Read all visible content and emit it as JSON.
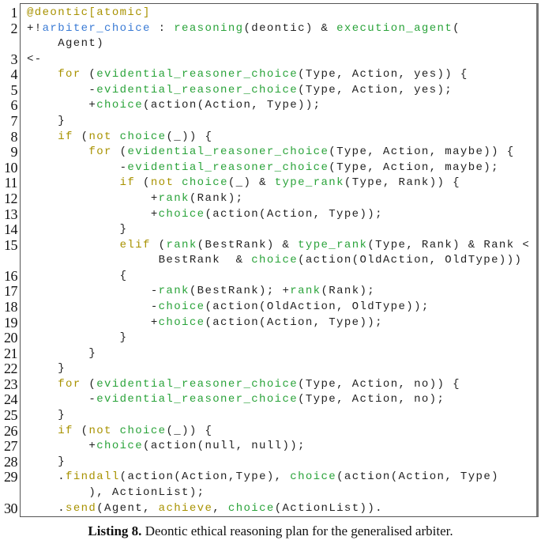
{
  "listing": {
    "caption_label": "Listing 8.",
    "caption_text": " Deontic ethical reasoning plan for the generalised arbiter.",
    "colors": {
      "keyword": "#a89200",
      "identifier": "#2aa33a",
      "goal": "#3a7bd5",
      "text": "#222222"
    },
    "lines": [
      {
        "n": "1",
        "tokens": [
          [
            "kw",
            "@deontic[atomic]"
          ]
        ]
      },
      {
        "n": "2",
        "tokens": [
          [
            "t",
            "+!"
          ],
          [
            "bl",
            "arbiter_choice"
          ],
          [
            "t",
            " : "
          ],
          [
            "fn",
            "reasoning"
          ],
          [
            "t",
            "(deontic) & "
          ],
          [
            "fn",
            "execution_agent"
          ],
          [
            "t",
            "("
          ]
        ]
      },
      {
        "n": "",
        "tokens": [
          [
            "t",
            "    Agent)"
          ]
        ]
      },
      {
        "n": "3",
        "tokens": [
          [
            "t",
            "<-"
          ]
        ]
      },
      {
        "n": "4",
        "tokens": [
          [
            "t",
            "    "
          ],
          [
            "kw",
            "for"
          ],
          [
            "t",
            " ("
          ],
          [
            "fn",
            "evidential_reasoner_choice"
          ],
          [
            "t",
            "(Type, Action, yes)) {"
          ]
        ]
      },
      {
        "n": "5",
        "tokens": [
          [
            "t",
            "        -"
          ],
          [
            "fn",
            "evidential_reasoner_choice"
          ],
          [
            "t",
            "(Type, Action, yes);"
          ]
        ]
      },
      {
        "n": "6",
        "tokens": [
          [
            "t",
            "        +"
          ],
          [
            "fn",
            "choice"
          ],
          [
            "t",
            "(action(Action, Type));"
          ]
        ]
      },
      {
        "n": "7",
        "tokens": [
          [
            "t",
            "    }"
          ]
        ]
      },
      {
        "n": "8",
        "tokens": [
          [
            "t",
            "    "
          ],
          [
            "kw",
            "if"
          ],
          [
            "t",
            " ("
          ],
          [
            "kw",
            "not"
          ],
          [
            "t",
            " "
          ],
          [
            "fn",
            "choice"
          ],
          [
            "t",
            "(_)) {"
          ]
        ]
      },
      {
        "n": "9",
        "tokens": [
          [
            "t",
            "        "
          ],
          [
            "kw",
            "for"
          ],
          [
            "t",
            " ("
          ],
          [
            "fn",
            "evidential_reasoner_choice"
          ],
          [
            "t",
            "(Type, Action, maybe)) {"
          ]
        ]
      },
      {
        "n": "10",
        "tokens": [
          [
            "t",
            "            -"
          ],
          [
            "fn",
            "evidential_reasoner_choice"
          ],
          [
            "t",
            "(Type, Action, maybe);"
          ]
        ]
      },
      {
        "n": "11",
        "tokens": [
          [
            "t",
            "            "
          ],
          [
            "kw",
            "if"
          ],
          [
            "t",
            " ("
          ],
          [
            "kw",
            "not"
          ],
          [
            "t",
            " "
          ],
          [
            "fn",
            "choice"
          ],
          [
            "t",
            "(_) & "
          ],
          [
            "fn",
            "type_rank"
          ],
          [
            "t",
            "(Type, Rank)) {"
          ]
        ]
      },
      {
        "n": "12",
        "tokens": [
          [
            "t",
            "                +"
          ],
          [
            "fn",
            "rank"
          ],
          [
            "t",
            "(Rank);"
          ]
        ]
      },
      {
        "n": "13",
        "tokens": [
          [
            "t",
            "                +"
          ],
          [
            "fn",
            "choice"
          ],
          [
            "t",
            "(action(Action, Type));"
          ]
        ]
      },
      {
        "n": "14",
        "tokens": [
          [
            "t",
            "            }"
          ]
        ]
      },
      {
        "n": "15",
        "tokens": [
          [
            "t",
            "            "
          ],
          [
            "kw",
            "elif"
          ],
          [
            "t",
            " ("
          ],
          [
            "fn",
            "rank"
          ],
          [
            "t",
            "(BestRank) & "
          ],
          [
            "fn",
            "type_rank"
          ],
          [
            "t",
            "(Type, Rank) & Rank <"
          ]
        ]
      },
      {
        "n": "",
        "tokens": [
          [
            "t",
            "                 BestRank  & "
          ],
          [
            "fn",
            "choice"
          ],
          [
            "t",
            "(action(OldAction, OldType)))"
          ]
        ]
      },
      {
        "n": "16",
        "tokens": [
          [
            "t",
            "            {"
          ]
        ]
      },
      {
        "n": "17",
        "tokens": [
          [
            "t",
            "                -"
          ],
          [
            "fn",
            "rank"
          ],
          [
            "t",
            "(BestRank); +"
          ],
          [
            "fn",
            "rank"
          ],
          [
            "t",
            "(Rank);"
          ]
        ]
      },
      {
        "n": "18",
        "tokens": [
          [
            "t",
            "                -"
          ],
          [
            "fn",
            "choice"
          ],
          [
            "t",
            "(action(OldAction, OldType));"
          ]
        ]
      },
      {
        "n": "19",
        "tokens": [
          [
            "t",
            "                +"
          ],
          [
            "fn",
            "choice"
          ],
          [
            "t",
            "(action(Action, Type));"
          ]
        ]
      },
      {
        "n": "20",
        "tokens": [
          [
            "t",
            "            }"
          ]
        ]
      },
      {
        "n": "21",
        "tokens": [
          [
            "t",
            "        }"
          ]
        ]
      },
      {
        "n": "22",
        "tokens": [
          [
            "t",
            "    }"
          ]
        ]
      },
      {
        "n": "23",
        "tokens": [
          [
            "t",
            "    "
          ],
          [
            "kw",
            "for"
          ],
          [
            "t",
            " ("
          ],
          [
            "fn",
            "evidential_reasoner_choice"
          ],
          [
            "t",
            "(Type, Action, no)) {"
          ]
        ]
      },
      {
        "n": "24",
        "tokens": [
          [
            "t",
            "        -"
          ],
          [
            "fn",
            "evidential_reasoner_choice"
          ],
          [
            "t",
            "(Type, Action, no);"
          ]
        ]
      },
      {
        "n": "25",
        "tokens": [
          [
            "t",
            "    }"
          ]
        ]
      },
      {
        "n": "26",
        "tokens": [
          [
            "t",
            "    "
          ],
          [
            "kw",
            "if"
          ],
          [
            "t",
            " ("
          ],
          [
            "kw",
            "not"
          ],
          [
            "t",
            " "
          ],
          [
            "fn",
            "choice"
          ],
          [
            "t",
            "(_)) {"
          ]
        ]
      },
      {
        "n": "27",
        "tokens": [
          [
            "t",
            "        +"
          ],
          [
            "fn",
            "choice"
          ],
          [
            "t",
            "(action(null, null));"
          ]
        ]
      },
      {
        "n": "28",
        "tokens": [
          [
            "t",
            "    }"
          ]
        ]
      },
      {
        "n": "29",
        "tokens": [
          [
            "t",
            "    ."
          ],
          [
            "kw",
            "findall"
          ],
          [
            "t",
            "(action(Action,Type), "
          ],
          [
            "fn",
            "choice"
          ],
          [
            "t",
            "(action(Action, Type)"
          ]
        ]
      },
      {
        "n": "",
        "tokens": [
          [
            "t",
            "        ), ActionList);"
          ]
        ]
      },
      {
        "n": "30",
        "tokens": [
          [
            "t",
            "    ."
          ],
          [
            "kw",
            "send"
          ],
          [
            "t",
            "(Agent, "
          ],
          [
            "kw",
            "achieve"
          ],
          [
            "t",
            ", "
          ],
          [
            "fn",
            "choice"
          ],
          [
            "t",
            "(ActionList))."
          ]
        ]
      }
    ]
  }
}
